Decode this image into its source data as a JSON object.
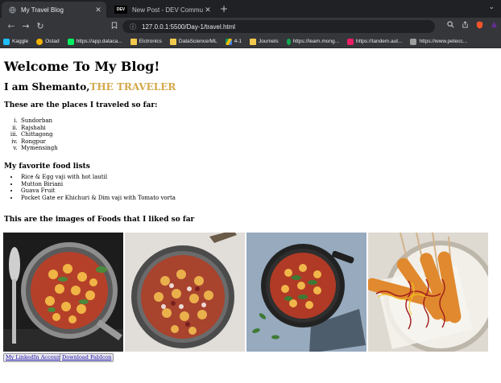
{
  "browser": {
    "tabs": [
      {
        "title": "My Travel Blog",
        "close": "✕"
      },
      {
        "favicon": "DEV",
        "title": "New Post - DEV Community",
        "close": "✕"
      }
    ],
    "new_tab": "+",
    "url": "127.0.0.1:5500/Day-1/travel.html",
    "bookmarks": [
      {
        "label": "Kaggle",
        "color": "#20beff"
      },
      {
        "label": "Ostad",
        "color": "#f5b300"
      },
      {
        "label": "https://app.dataca...",
        "color": "#03ef62"
      },
      {
        "label": "Elctronics",
        "color": "#f2c94c"
      },
      {
        "label": "DataScience/ML",
        "color": "#f2c94c"
      },
      {
        "label": "4-1",
        "color": "#fbbc04"
      },
      {
        "label": "Journels",
        "color": "#f2c94c"
      },
      {
        "label": "https://learn.mong...",
        "color": "#13aa52"
      },
      {
        "label": "https://tandem.aut...",
        "color": "#e91e63"
      },
      {
        "label": "https://www.petecc...",
        "color": "#9e9e9e"
      }
    ]
  },
  "page": {
    "title": "Welcome To My Blog!",
    "intro_prefix": "I am Shemanto,",
    "intro_accent": "THE TRAVELER",
    "accent_color": "#d4a84b",
    "places_heading": "These are the places I traveled so far:",
    "places": [
      "Sundorban",
      "Rajshahi",
      "Chittagong",
      "Rongpur",
      "Mymensingh"
    ],
    "foods_heading": "My favorite food lists",
    "foods": [
      "Rice & Egg vaji with hot lautil",
      "Mutton Biriani",
      "Guava Fruit",
      "Pocket Gate er Khichuri & Dim vaji with Tomato vorta"
    ],
    "images_heading": "This are the images of Foods that I liked so far",
    "buttons": {
      "linkedin": "My LinkedIn Account",
      "download": "Download FabIcon"
    }
  }
}
